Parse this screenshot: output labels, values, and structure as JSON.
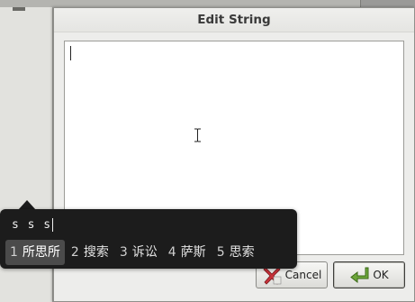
{
  "dialog": {
    "title": "Edit String",
    "text_value": "",
    "cancel_label": "Cancel",
    "ok_label": "OK"
  },
  "ime": {
    "preedit": "s s s",
    "selected_index": 0,
    "candidates": [
      {
        "num": "1",
        "text": "所思所"
      },
      {
        "num": "2",
        "text": "搜索"
      },
      {
        "num": "3",
        "text": "诉讼"
      },
      {
        "num": "4",
        "text": "萨斯"
      },
      {
        "num": "5",
        "text": "思索"
      }
    ]
  },
  "icons": {
    "cancel": "cancel-icon",
    "ok": "ok-arrow-icon",
    "cursor": "ibeam-cursor-icon"
  },
  "colors": {
    "ime_background": "#1c1c1c",
    "ime_selected": "#4b4b4b",
    "ok_icon_green": "#6da63a",
    "cancel_icon_red": "#c8323a"
  }
}
